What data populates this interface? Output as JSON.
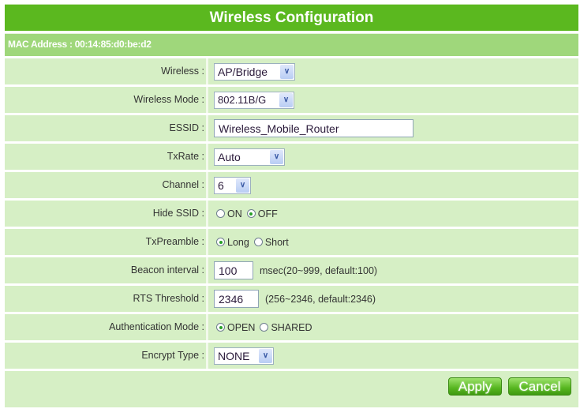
{
  "header": {
    "title": "Wireless Configuration"
  },
  "mac": {
    "label": "MAC Address : 00:14:85:d0:be:d2"
  },
  "fields": {
    "wireless": {
      "label": "Wireless :",
      "value": "AP/Bridge"
    },
    "wireless_mode": {
      "label": "Wireless Mode :",
      "value": "802.11B/G"
    },
    "essid": {
      "label": "ESSID :",
      "value": "Wireless_Mobile_Router"
    },
    "txrate": {
      "label": "TxRate :",
      "value": "Auto"
    },
    "channel": {
      "label": "Channel :",
      "value": "6"
    },
    "hide_ssid": {
      "label": "Hide SSID :",
      "options": [
        "ON",
        "OFF"
      ],
      "selected": "OFF"
    },
    "txpreamble": {
      "label": "TxPreamble :",
      "options": [
        "Long",
        "Short"
      ],
      "selected": "Long"
    },
    "beacon": {
      "label": "Beacon interval :",
      "value": "100",
      "hint": "msec(20~999, default:100)"
    },
    "rts": {
      "label": "RTS Threshold :",
      "value": "2346",
      "hint": "(256~2346, default:2346)"
    },
    "auth": {
      "label": "Authentication Mode :",
      "options": [
        "OPEN",
        "SHARED"
      ],
      "selected": "OPEN"
    },
    "encrypt": {
      "label": "Encrypt Type :",
      "value": "NONE"
    }
  },
  "buttons": {
    "apply": "Apply",
    "cancel": "Cancel"
  }
}
